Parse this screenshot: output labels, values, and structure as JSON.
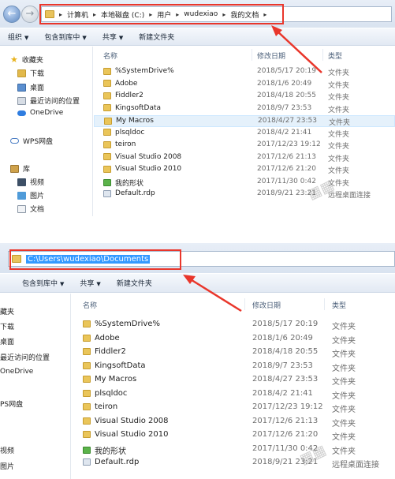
{
  "screen1": {
    "breadcrumbs": [
      "计算机",
      "本地磁盘 (C:)",
      "用户",
      "wudexiao",
      "我的文档"
    ],
    "toolbar": [
      "组织",
      "包含到库中",
      "共享",
      "新建文件夹"
    ],
    "nav": [
      {
        "label": "收藏夹",
        "icon": "star-icon"
      },
      {
        "label": "下载",
        "icon": "download-folder-icon"
      },
      {
        "label": "桌面",
        "icon": "desktop-icon"
      },
      {
        "label": "最近访问的位置",
        "icon": "recent-places-icon"
      },
      {
        "label": "OneDrive",
        "icon": "onedrive-cloud-icon"
      },
      {
        "label": "WPS网盘",
        "icon": "wps-cloud-icon"
      },
      {
        "label": "库",
        "icon": "library-icon"
      },
      {
        "label": "视频",
        "icon": "video-library-icon"
      },
      {
        "label": "图片",
        "icon": "picture-library-icon"
      },
      {
        "label": "文档",
        "icon": "document-library-icon"
      }
    ]
  },
  "screen2": {
    "path": "C:\\Users\\wudexiao\\Documents",
    "toolbar": [
      "包含到库中",
      "共享",
      "新建文件夹"
    ],
    "nav": [
      "藏夹",
      "下载",
      "桌面",
      "最近访问的位置",
      "OneDrive",
      "PS网盘",
      "视频",
      "图片"
    ]
  },
  "columns": {
    "name": "名称",
    "date": "修改日期",
    "type": "类型"
  },
  "files": [
    {
      "name": "%SystemDrive%",
      "date": "2018/5/17 20:19",
      "type": "文件夹",
      "icon": "folder-icon"
    },
    {
      "name": "Adobe",
      "date": "2018/1/6 20:49",
      "type": "文件夹",
      "icon": "folder-icon"
    },
    {
      "name": "Fiddler2",
      "date": "2018/4/18 20:55",
      "type": "文件夹",
      "icon": "folder-icon"
    },
    {
      "name": "KingsoftData",
      "date": "2018/9/7 23:53",
      "type": "文件夹",
      "icon": "folder-icon"
    },
    {
      "name": "My Macros",
      "date": "2018/4/27 23:53",
      "type": "文件夹",
      "icon": "folder-icon"
    },
    {
      "name": "plsqldoc",
      "date": "2018/4/2 21:41",
      "type": "文件夹",
      "icon": "folder-icon"
    },
    {
      "name": "teiron",
      "date": "2017/12/23 19:12",
      "type": "文件夹",
      "icon": "folder-icon"
    },
    {
      "name": "Visual Studio 2008",
      "date": "2017/12/6 21:13",
      "type": "文件夹",
      "icon": "folder-icon"
    },
    {
      "name": "Visual Studio 2010",
      "date": "2017/12/6 21:20",
      "type": "文件夹",
      "icon": "folder-icon"
    },
    {
      "name": "我的形状",
      "date": "2017/11/30 0:42",
      "type": "文件夹",
      "icon": "shapes-folder-icon"
    },
    {
      "name": "Default.rdp",
      "date": "2018/9/21 23:21",
      "type": "远程桌面连接",
      "icon": "rdp-file-icon"
    }
  ],
  "colors": {
    "highlight": "#3399ff",
    "annotation": "#e9362b",
    "selection": "#e5f1fb"
  }
}
